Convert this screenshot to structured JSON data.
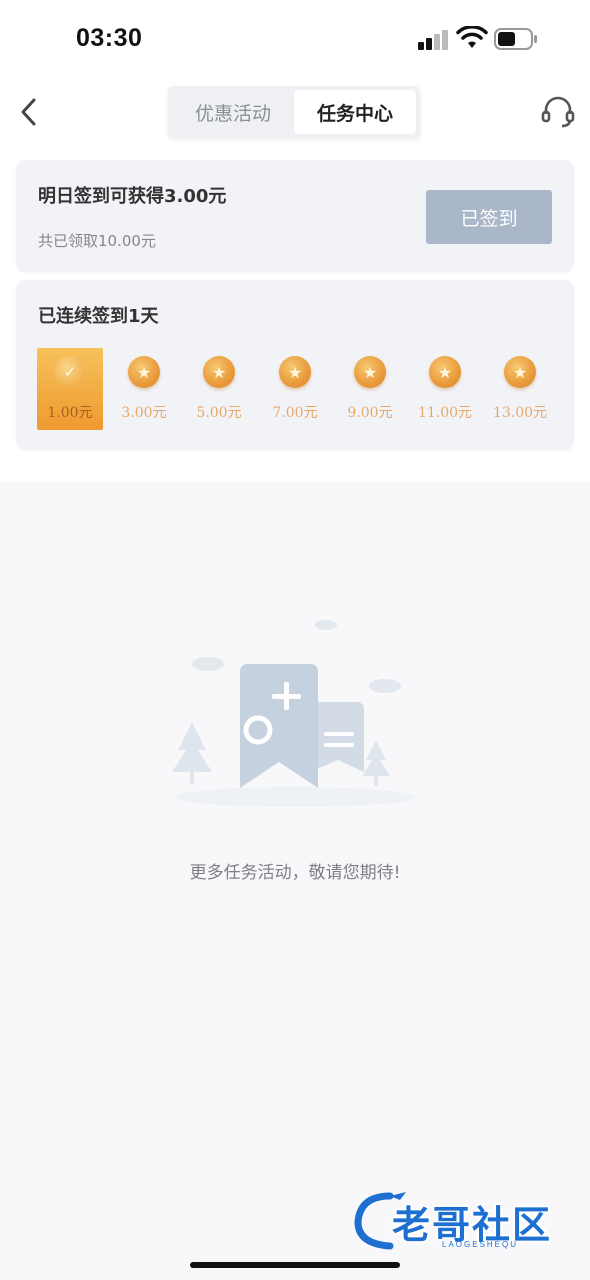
{
  "status_bar": {
    "time": "03:30"
  },
  "nav": {
    "tabs": [
      {
        "label": "优惠活动",
        "active": false
      },
      {
        "label": "任务中心",
        "active": true
      }
    ]
  },
  "signin": {
    "tomorrow_text": "明日签到可获得3.00元",
    "total_text": "共已领取10.00元",
    "button_label": "已签到"
  },
  "streak": {
    "title": "已连续签到1天",
    "days": [
      {
        "amount": "1.00元",
        "checked": true
      },
      {
        "amount": "3.00元",
        "checked": false
      },
      {
        "amount": "5.00元",
        "checked": false
      },
      {
        "amount": "7.00元",
        "checked": false
      },
      {
        "amount": "9.00元",
        "checked": false
      },
      {
        "amount": "11.00元",
        "checked": false
      },
      {
        "amount": "13.00元",
        "checked": false
      }
    ]
  },
  "empty_state": {
    "message": "更多任务活动，敬请您期待!"
  },
  "watermark": {
    "title": "老哥社区",
    "subtitle": "LAOGESHEQU"
  },
  "colors": {
    "accent_gold": "#ee9a30",
    "button_disabled": "#a9b7c8",
    "card_bg": "#f2f3f7"
  }
}
